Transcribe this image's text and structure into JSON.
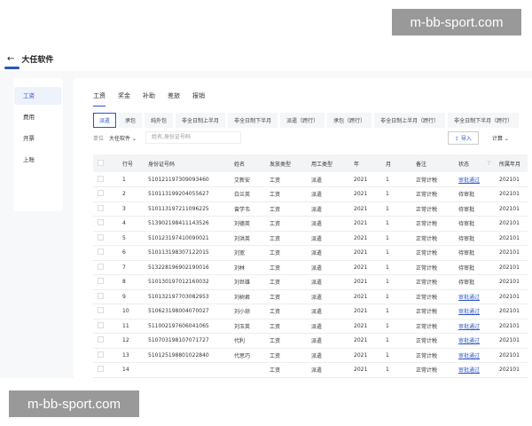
{
  "watermark": "m-bb-sport.com",
  "header": {
    "title": "大任软件",
    "back_icon": "arrow-left"
  },
  "sidebar": {
    "items": [
      {
        "label": "工资"
      },
      {
        "label": "费用"
      },
      {
        "label": "开票"
      },
      {
        "label": "上账"
      }
    ]
  },
  "tabs": [
    {
      "label": "工资"
    },
    {
      "label": "奖金"
    },
    {
      "label": "补助"
    },
    {
      "label": "差旅"
    },
    {
      "label": "报销"
    }
  ],
  "pills": [
    {
      "label": "派遣"
    },
    {
      "label": "承包"
    },
    {
      "label": "纯外包"
    },
    {
      "label": "非全日制上半月"
    },
    {
      "label": "非全日制下半月"
    },
    {
      "label": "派遣（跨行）"
    },
    {
      "label": "承包（跨行）"
    },
    {
      "label": "非全日制上半月（跨行）"
    },
    {
      "label": "非全日制下半月（跨行）"
    }
  ],
  "filters": {
    "unit_label": "单位",
    "unit_value": "大任软件 ⌄",
    "search_placeholder": "姓名,身份证号码",
    "import_label": "⇪ 导入",
    "calc_label": "计算 ⌄"
  },
  "table": {
    "headers": [
      "行号",
      "身份证号码",
      "姓名",
      "发放类型",
      "用工类型",
      "年",
      "月",
      "备注",
      "状态",
      "所属年月"
    ],
    "rows": [
      [
        "1",
        "510121197309093460",
        "艾新安",
        "工资",
        "派遣",
        "2021",
        "1",
        "正常计税",
        "审批通过",
        "202101"
      ],
      [
        "2",
        "510113199204055627",
        "白兰英",
        "工资",
        "派遣",
        "2021",
        "1",
        "正常计税",
        "待审批",
        "202101"
      ],
      [
        "3",
        "510113197211096225",
        "曾学韦",
        "工资",
        "派遣",
        "2021",
        "1",
        "正常计税",
        "待审批",
        "202101"
      ],
      [
        "4",
        "513902198411143526",
        "刘德英",
        "工资",
        "派遣",
        "2021",
        "1",
        "正常计税",
        "待审批",
        "202101"
      ],
      [
        "5",
        "510123197410090021",
        "刘洪英",
        "工资",
        "派遣",
        "2021",
        "1",
        "正常计税",
        "待审批",
        "202101"
      ],
      [
        "6",
        "510113198307122015",
        "刘宽",
        "工资",
        "派遣",
        "2021",
        "1",
        "正常计税",
        "待审批",
        "202101"
      ],
      [
        "7",
        "513228196902190016",
        "刘林",
        "工资",
        "派遣",
        "2021",
        "1",
        "正常计税",
        "待审批",
        "202101"
      ],
      [
        "8",
        "510130197012160032",
        "刘世雄",
        "工资",
        "派遣",
        "2021",
        "1",
        "正常计税",
        "待审批",
        "202101"
      ],
      [
        "9",
        "510132197703082953",
        "刘树君",
        "工资",
        "派遣",
        "2021",
        "1",
        "正常计税",
        "审批通过",
        "202101"
      ],
      [
        "10",
        "510623198004070027",
        "刘小琼",
        "工资",
        "派遣",
        "2021",
        "1",
        "正常计税",
        "审批通过",
        "202101"
      ],
      [
        "11",
        "511002197606041065",
        "刘玉英",
        "工资",
        "派遣",
        "2021",
        "1",
        "正常计税",
        "审批通过",
        "202101"
      ],
      [
        "12",
        "510703198107071727",
        "代利",
        "工资",
        "派遣",
        "2021",
        "1",
        "正常计税",
        "审批通过",
        "202101"
      ],
      [
        "13",
        "510125198801022840",
        "代思巧",
        "工资",
        "派遣",
        "2021",
        "1",
        "正常计税",
        "审批通过",
        "202101"
      ],
      [
        "14",
        "",
        "",
        "工资",
        "派遣",
        "2021",
        "1",
        "正常计税",
        "审批通过",
        "202101"
      ]
    ]
  },
  "colors": {
    "accent": "#2b56c6"
  }
}
